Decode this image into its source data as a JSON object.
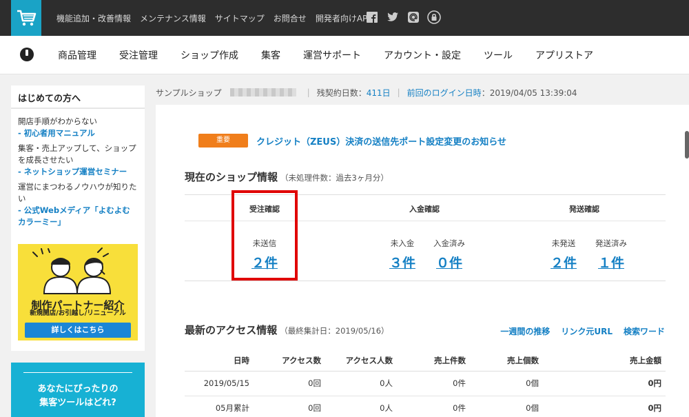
{
  "topbar": {
    "links": [
      "機能追加・改善情報",
      "メンテナンス情報",
      "サイトマップ",
      "お問合せ",
      "開発者向けAPI"
    ],
    "social_icons": [
      "facebook-icon",
      "twitter-icon",
      "mail-icon",
      "lock-icon"
    ],
    "brand_color": "#1aa3c6"
  },
  "nav": {
    "items": [
      "商品管理",
      "受注管理",
      "ショップ作成",
      "集客",
      "運営サポート",
      "アカウント・設定",
      "ツール",
      "アプリストア"
    ]
  },
  "sidebar": {
    "title": "はじめての方へ",
    "blocks": [
      {
        "text": "開店手順がわからない",
        "link": "- 初心者用マニュアル"
      },
      {
        "text": "集客・売上アップして、ショップを成長させたい",
        "link": "- ネットショップ運営セミナー"
      },
      {
        "text": "運営にまつわるノウハウが知りたい",
        "link": "- 公式Webメディア「よむよむカラーミー」"
      }
    ],
    "banner": {
      "line1": "新規開店/お引越し/リニューアル",
      "line2": "制作パートナー紹介",
      "button": "詳しくはこちら"
    },
    "promo": {
      "line1": "あなたにぴったりの",
      "line2": "集客ツールはどれ?"
    }
  },
  "infostrip": {
    "shop_name": "サンプルショップ",
    "days_label": "残契約日数：",
    "days_value": "411日",
    "login_label": "前回のログイン日時",
    "login_value": "：2019/04/05 13:39:04"
  },
  "notice": {
    "badge": "重要",
    "text": "クレジット（ZEUS）決済の送信先ポート設定変更のお知らせ"
  },
  "shopinfo": {
    "title": "現在のショップ情報",
    "subtitle": "（未処理件数：過去3ヶ月分）",
    "columns": [
      {
        "head": "受注確認",
        "cells": [
          {
            "label": "未送信",
            "value": "２件"
          }
        ]
      },
      {
        "head": "入金確認",
        "cells": [
          {
            "label": "未入金",
            "value": "３件"
          },
          {
            "label": "入金済み",
            "value": "０件"
          }
        ]
      },
      {
        "head": "発送確認",
        "cells": [
          {
            "label": "未発送",
            "value": "２件"
          },
          {
            "label": "発送済み",
            "value": "１件"
          }
        ]
      }
    ]
  },
  "access": {
    "title": "最新のアクセス情報",
    "subtitle": "（最終集計日：2019/05/16）",
    "links": [
      "一週間の推移",
      "リンク元URL",
      "検索ワード"
    ],
    "headers": [
      "日時",
      "アクセス数",
      "アクセス人数",
      "売上件数",
      "売上個数",
      "売上金額"
    ],
    "rows": [
      [
        "2019/05/15",
        "0回",
        "0人",
        "0件",
        "0個",
        "0円"
      ],
      [
        "05月累計",
        "0回",
        "0人",
        "0件",
        "0個",
        "0円"
      ]
    ]
  },
  "colors": {
    "link": "#1580c4",
    "badge": "#f07e1b",
    "highlight": "#e00000"
  }
}
